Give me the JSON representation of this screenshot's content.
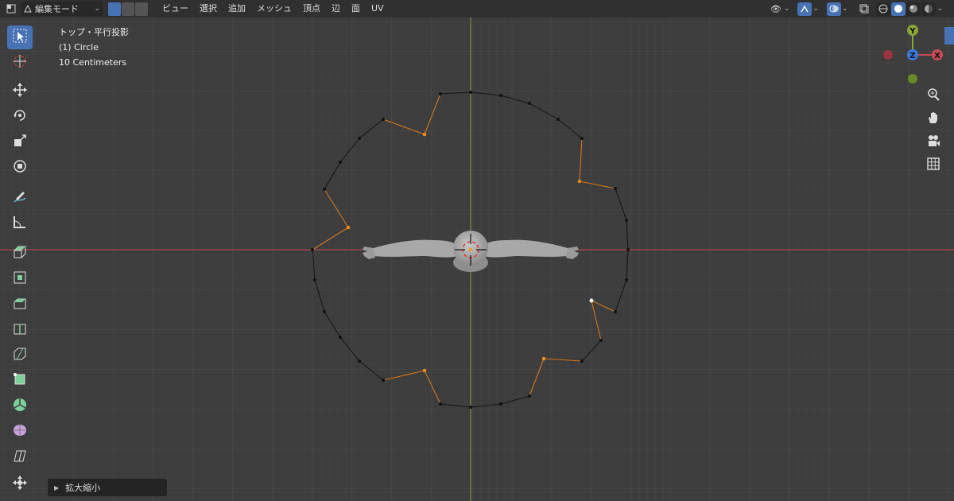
{
  "header": {
    "mode_label": "編集モード",
    "menus": [
      "ビュー",
      "選択",
      "追加",
      "メッシュ",
      "頂点",
      "辺",
      "面",
      "UV"
    ]
  },
  "overlay": {
    "view_name": "トップ・平行投影",
    "object_name": "(1) Circle",
    "scale": "10 Centimeters"
  },
  "gizmo": {
    "y_label": "Y",
    "z_label": "Z",
    "x_label": "X"
  },
  "last_operator": {
    "label": "拡大縮小"
  },
  "icons": {
    "tools": [
      "select-box-icon",
      "cursor-icon",
      "move-icon",
      "rotate-icon",
      "scale-icon",
      "transform-icon",
      "annotate-icon",
      "measure-icon",
      "extrude-icon",
      "inset-icon",
      "bevel-icon",
      "loop-cut-icon",
      "knife-icon",
      "poly-build-icon",
      "spin-icon",
      "smooth-icon",
      "shear-icon",
      "shrink-fatten-icon"
    ],
    "nav": [
      "zoom-icon",
      "pan-hand-icon",
      "camera-icon",
      "grid-view-icon"
    ]
  },
  "colors": {
    "viewport": "#3d3d3d",
    "header": "#303030",
    "accent": "#4772b3",
    "x_axis": "#c44b55",
    "y_axis": "#8aa33a",
    "z_axis": "#3b79d8",
    "edge": "#101010",
    "selected_edge": "#d97a1f"
  }
}
